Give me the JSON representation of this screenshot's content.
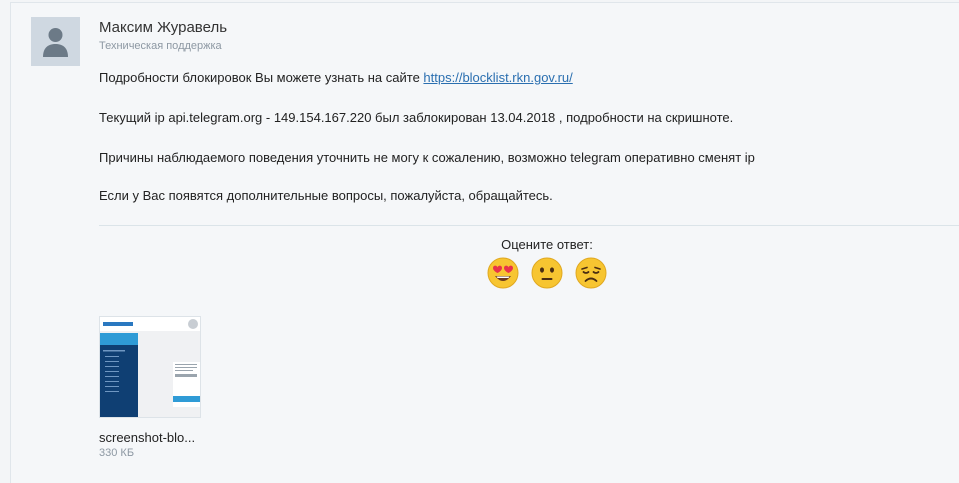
{
  "message": {
    "author_name": "Максим Журавель",
    "author_role": "Техническая поддержка",
    "paragraphs": {
      "p1_text": "Подробности блокировок Вы можете узнать на сайте ",
      "p1_link": "https://blocklist.rkn.gov.ru/",
      "p2": "Текущий ip api.telegram.org - 149.154.167.220 был заблокирован 13.04.2018 , подробности на скришноте.",
      "p3": "Причины наблюдаемого поведения уточнить не могу к сожалению, возможно telegram оперативно сменят ip",
      "p4": "Если у Вас появятся дополнительные вопросы, пожалуйста, обращайтесь."
    }
  },
  "rating": {
    "label": "Оцените ответ:",
    "options": [
      "heart-eyes-emoji",
      "neutral-face-emoji",
      "sad-face-emoji"
    ]
  },
  "attachment": {
    "filename": "screenshot-blo...",
    "size": "330 КБ",
    "thumbnail_icon": "screenshot-thumbnail"
  },
  "colors": {
    "link": "#2a6fb0",
    "muted": "#8d98a3",
    "emoji_yellow": "#f7c531",
    "heart_red": "#e8334a"
  }
}
